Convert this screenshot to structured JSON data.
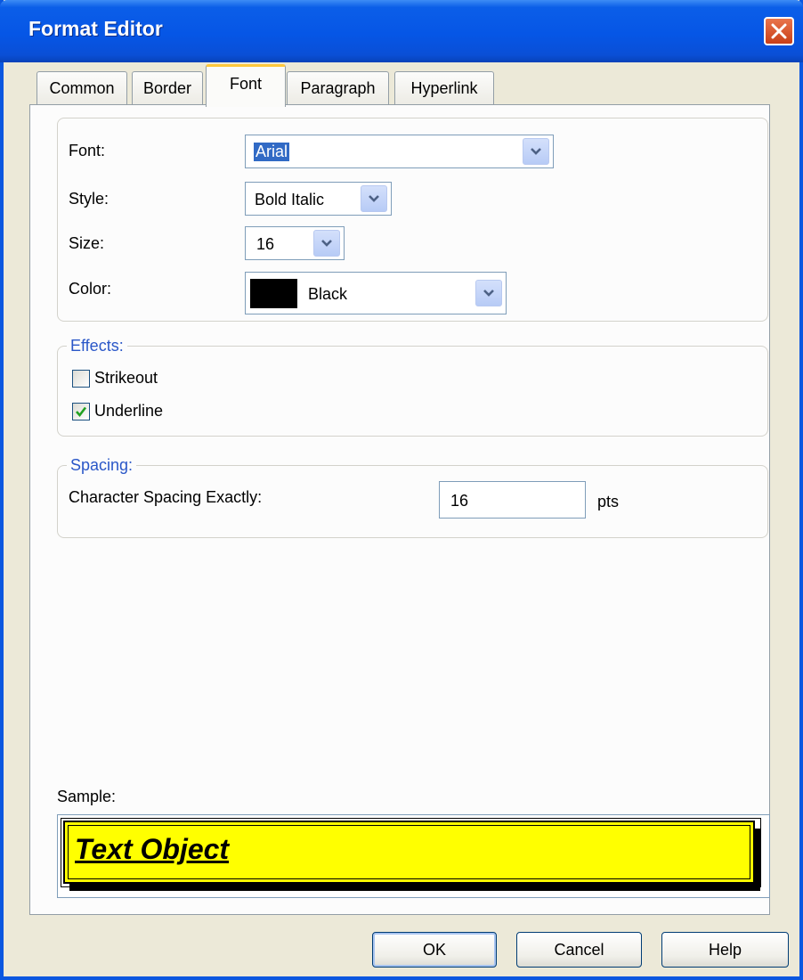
{
  "window": {
    "title": "Format Editor"
  },
  "tabs": [
    {
      "label": "Common"
    },
    {
      "label": "Border"
    },
    {
      "label": "Font",
      "selected": true
    },
    {
      "label": "Paragraph"
    },
    {
      "label": "Hyperlink"
    }
  ],
  "font": {
    "font_label": "Font:",
    "font_value": "Arial",
    "style_label": "Style:",
    "style_value": "Bold Italic",
    "size_label": "Size:",
    "size_value": "16",
    "color_label": "Color:",
    "color_value": "Black",
    "color_swatch": "#000000"
  },
  "effects": {
    "legend": "Effects:",
    "strikeout_label": "Strikeout",
    "strikeout_checked": false,
    "underline_label": "Underline",
    "underline_checked": true
  },
  "spacing": {
    "legend": "Spacing:",
    "label": "Character Spacing Exactly:",
    "value": "16",
    "unit": "pts"
  },
  "sample": {
    "label": "Sample:",
    "text": "Text Object",
    "background": "#ffff00"
  },
  "buttons": {
    "ok": "OK",
    "cancel": "Cancel",
    "help": "Help"
  },
  "icons": {
    "close": "close-icon",
    "dropdown": "chevron-down-icon",
    "check": "check-icon"
  }
}
